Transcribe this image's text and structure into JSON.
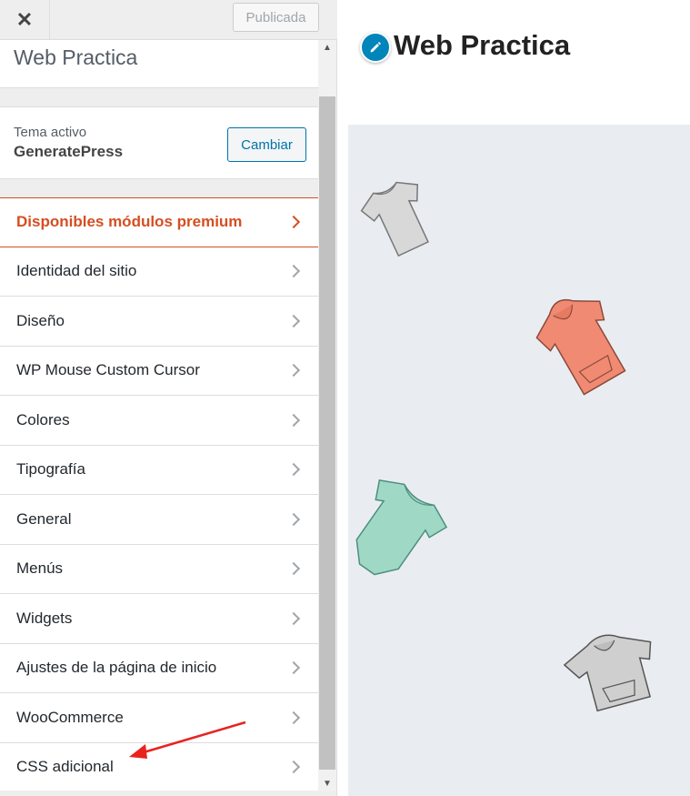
{
  "topbar": {
    "close_icon": "✕",
    "publish_label": "Publicada"
  },
  "site_title": "Web Practica",
  "theme": {
    "label": "Tema activo",
    "name": "GeneratePress",
    "change_label": "Cambiar"
  },
  "menu": [
    {
      "label": "Disponibles módulos premium",
      "premium": true
    },
    {
      "label": "Identidad del sitio"
    },
    {
      "label": "Diseño"
    },
    {
      "label": "WP Mouse Custom Cursor"
    },
    {
      "label": "Colores"
    },
    {
      "label": "Tipografía"
    },
    {
      "label": "General"
    },
    {
      "label": "Menús"
    },
    {
      "label": "Widgets"
    },
    {
      "label": "Ajustes de la página de inicio"
    },
    {
      "label": "WooCommerce"
    },
    {
      "label": "CSS adicional"
    }
  ],
  "preview": {
    "title": "Web Practica",
    "edit_icon": "pencil-icon"
  },
  "colors": {
    "accent": "#0073aa",
    "premium": "#d54e21",
    "arrow": "#e8231f",
    "shirt_gray": "#d8d8d8",
    "hoodie_coral": "#f08a73",
    "bodysuit_mint": "#9fd9c6",
    "hoodie_gray": "#cfcfcf"
  }
}
